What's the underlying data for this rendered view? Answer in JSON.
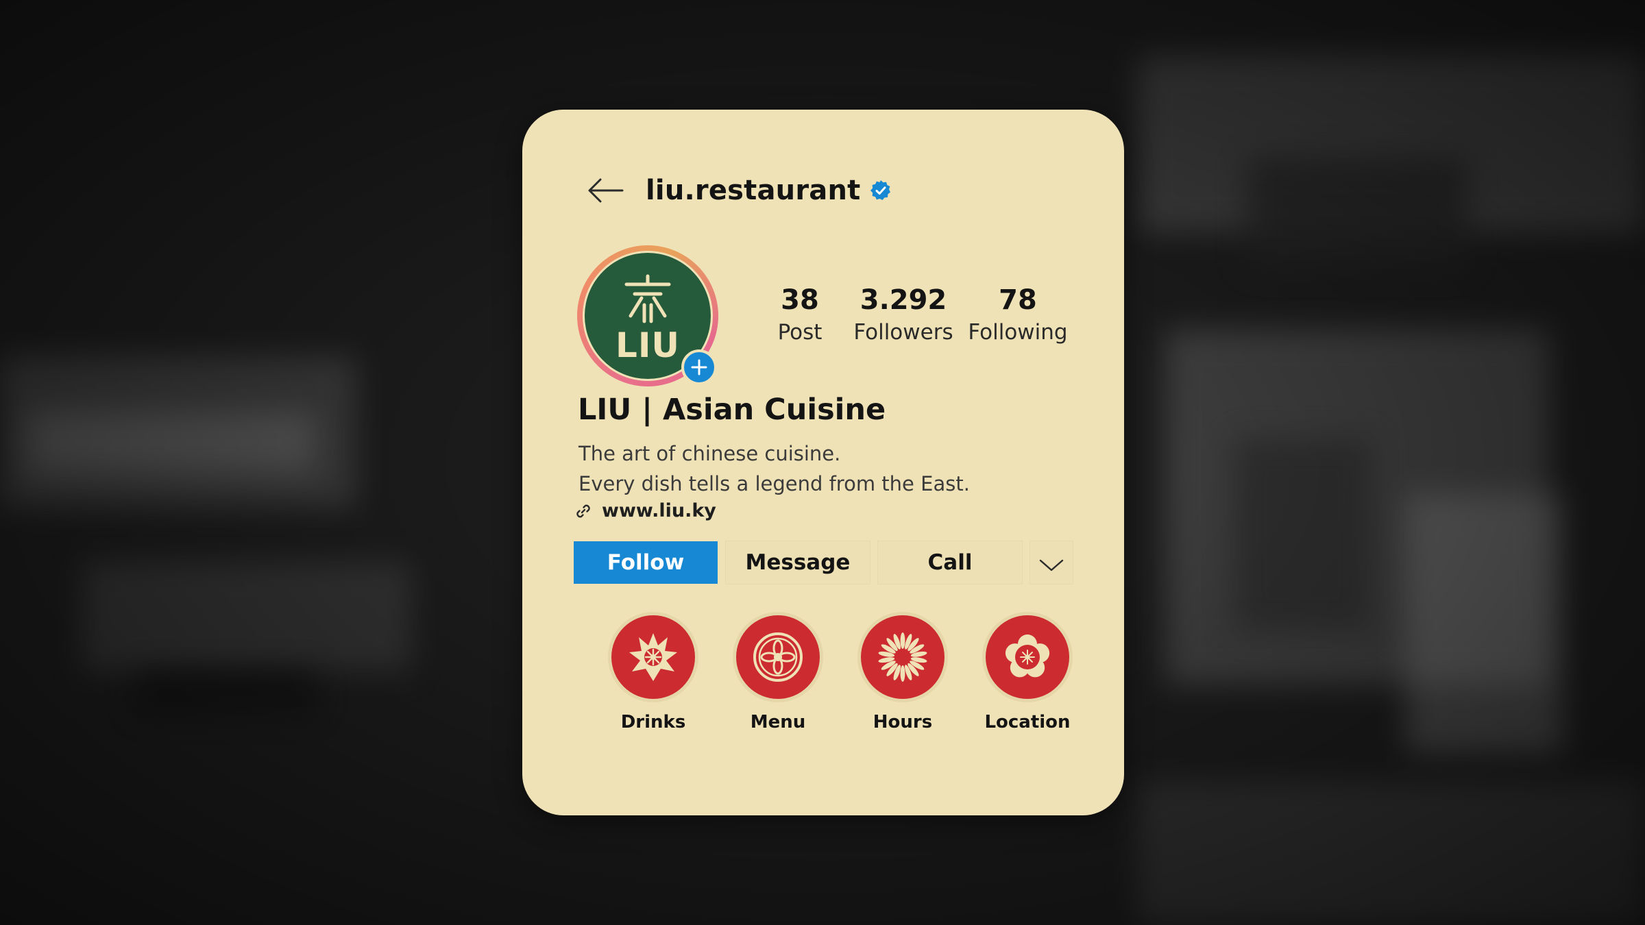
{
  "profile": {
    "username": "liu.restaurant",
    "verified": true,
    "logo_text": "LIU",
    "display_name": "LIU | Asian Cuisine",
    "bio_lines": [
      "The art of chinese cuisine.",
      "Every dish tells a legend from the East."
    ],
    "website": "www.liu.ky"
  },
  "stats": {
    "posts": {
      "value": "38",
      "label": "Post"
    },
    "followers": {
      "value": "3.292",
      "label": "Followers"
    },
    "following": {
      "value": "78",
      "label": "Following"
    }
  },
  "actions": {
    "follow": "Follow",
    "message": "Message",
    "call": "Call"
  },
  "highlights": [
    {
      "label": "Drinks",
      "icon": "lotus-flower-icon"
    },
    {
      "label": "Menu",
      "icon": "mandala-flower-icon"
    },
    {
      "label": "Hours",
      "icon": "chrysanthemum-icon"
    },
    {
      "label": "Location",
      "icon": "plum-blossom-icon"
    }
  ],
  "colors": {
    "card_bg": "#efe2b6",
    "avatar_green": "#255a3b",
    "accent_blue": "#1789d4",
    "highlight_red": "#cc2c2f"
  }
}
